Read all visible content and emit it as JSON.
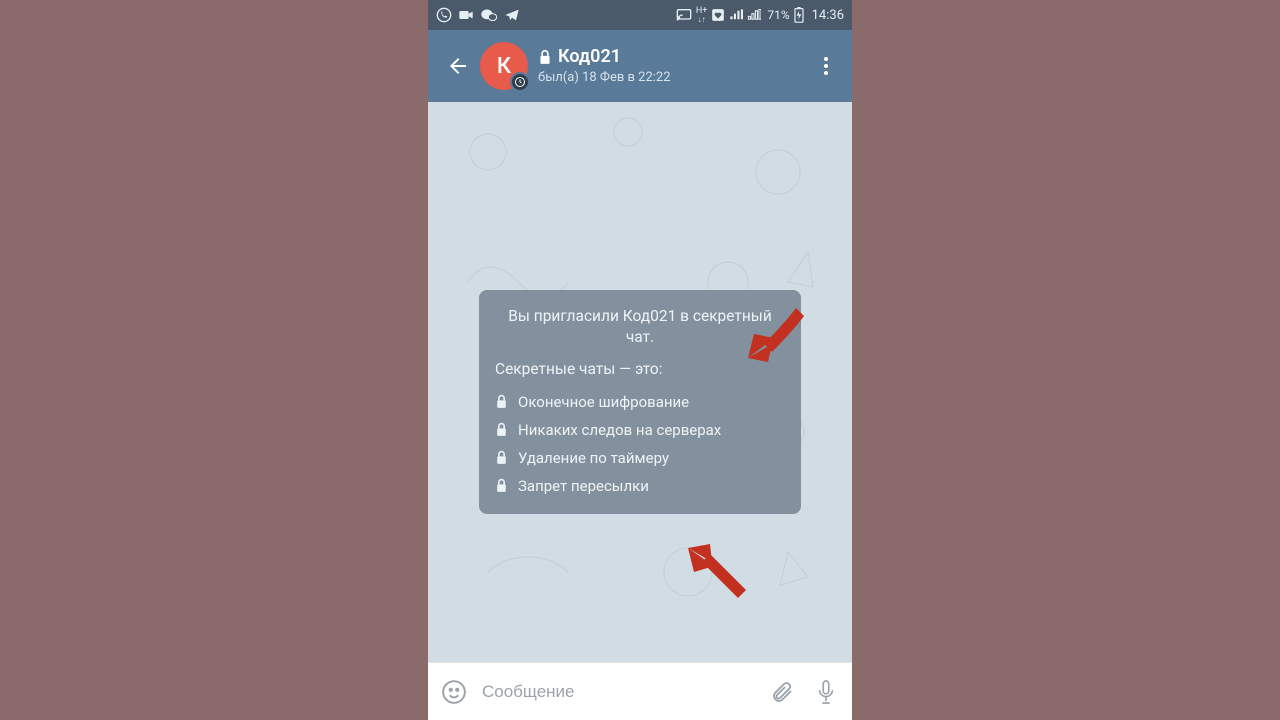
{
  "statusbar": {
    "battery_pct": "71%",
    "time": "14:36",
    "net_label": "H+"
  },
  "header": {
    "avatar_initial": "К",
    "title": "Код021",
    "subtitle": "был(а) 18 Фев в 22:22"
  },
  "info_card": {
    "invite_line": "Вы пригласили Код021 в секретный чат.",
    "heading": "Секретные чаты — это:",
    "features": [
      "Оконечное шифрование",
      "Никаких следов на серверах",
      "Удаление по таймеру",
      "Запрет пересылки"
    ]
  },
  "input": {
    "placeholder": "Сообщение"
  },
  "colors": {
    "header_bg": "#5a7a99",
    "card_bg": "rgba(120,134,148,0.88)",
    "avatar_bg": "#e85b4a",
    "arrow": "#c23020"
  }
}
